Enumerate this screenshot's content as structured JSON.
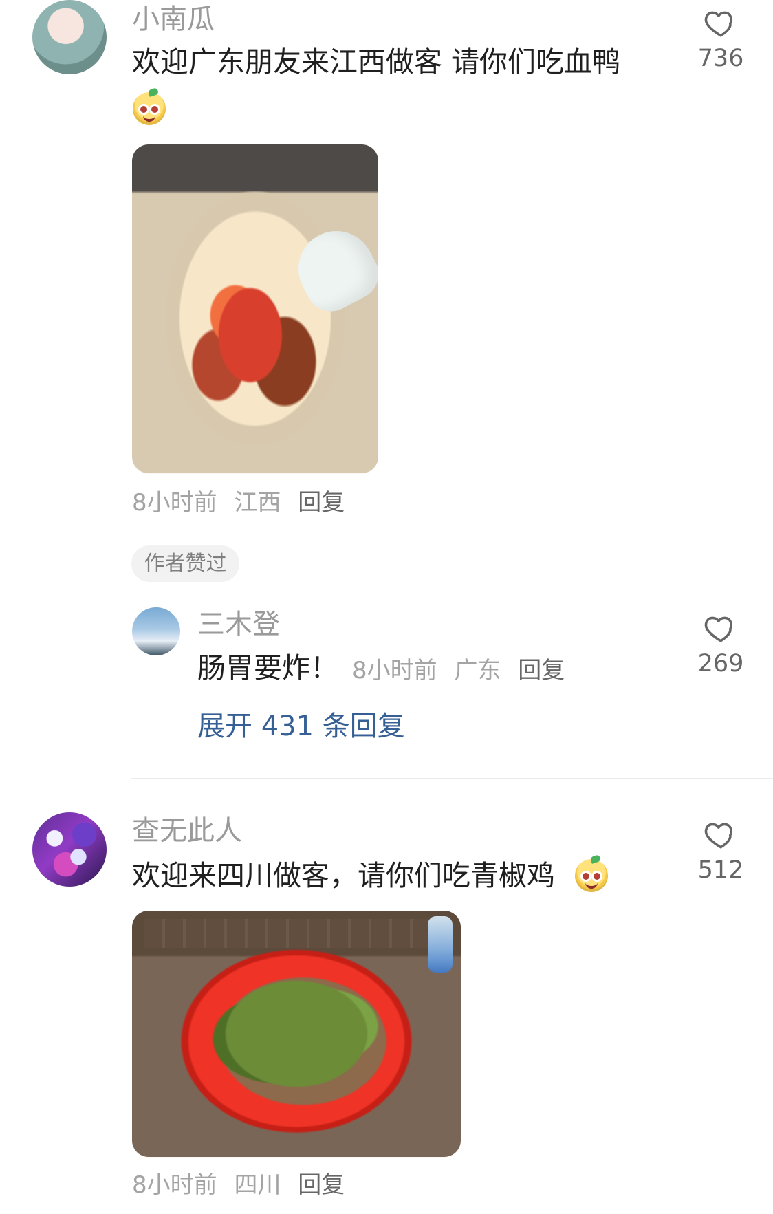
{
  "comments": [
    {
      "username": "小南瓜",
      "text_line1": "欢迎广东朋友来江西做客 请你们吃血鸭",
      "time": "8小时前",
      "location": "江西",
      "reply_label": "回复",
      "likes": "736",
      "author_liked_label": "作者赞过"
    },
    {
      "username": "查无此人",
      "text": "欢迎来四川做客，请你们吃青椒鸡",
      "time": "8小时前",
      "location": "四川",
      "reply_label": "回复",
      "likes": "512"
    }
  ],
  "reply": {
    "username": "三木登",
    "text": "肠胃要炸！",
    "time": "8小时前",
    "location": "广东",
    "reply_label": "回复",
    "likes": "269",
    "expand_label": "展开 431 条回复"
  },
  "icons": {
    "heart": "heart-outline-icon",
    "emoji": "cute-face-emoji-icon"
  }
}
